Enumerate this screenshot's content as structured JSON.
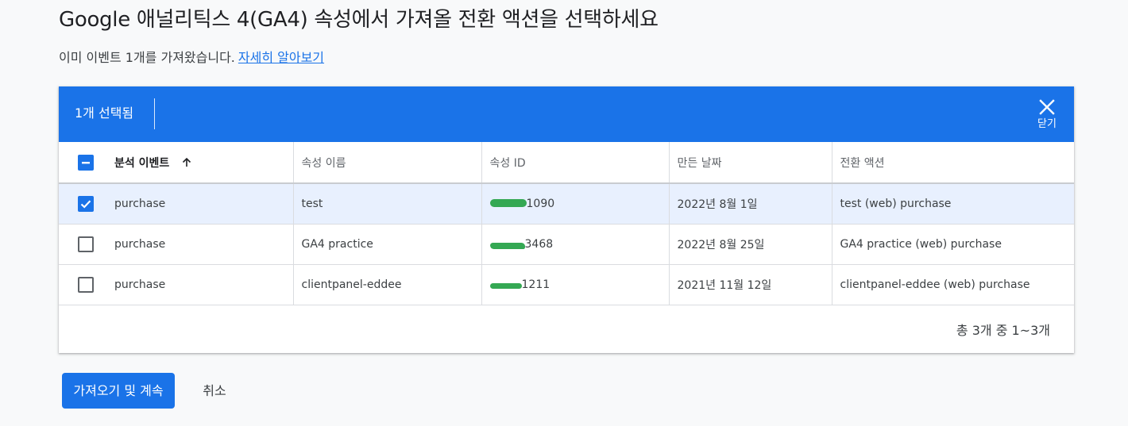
{
  "header": {
    "title": "Google 애널리틱스 4(GA4) 속성에서 가져올 전환 액션을 선택하세요",
    "subtitle_text": "이미 이벤트 1개를 가져왔습니다.",
    "learn_more_link": "자세히 알아보기"
  },
  "selection_bar": {
    "count_label": "1개 선택됨",
    "close_label": "닫기",
    "background_color": "#1a73e8"
  },
  "table": {
    "columns": [
      "분석 이벤트",
      "속성 이름",
      "속성 ID",
      "만든 날짜",
      "전환 액션"
    ],
    "sorted_column": "분석 이벤트",
    "sort_direction": "ascending",
    "header_checkbox_state": "indeterminate",
    "rows": [
      {
        "selected": true,
        "event": "purchase",
        "property_name": "test",
        "property_id_visible": "1090",
        "created": "2022년 8월 1일",
        "conversion_action": "test (web) purchase"
      },
      {
        "selected": false,
        "event": "purchase",
        "property_name": "GA4 practice",
        "property_id_visible": "3468",
        "created": "2022년 8월 25일",
        "conversion_action": "GA4 practice (web) purchase"
      },
      {
        "selected": false,
        "event": "purchase",
        "property_name": "clientpanel-eddee",
        "property_id_visible": "1211",
        "created": "2021년 11월 12일",
        "conversion_action": "clientpanel-eddee (web) purchase"
      }
    ],
    "pagination": "총 3개 중 1~3개"
  },
  "actions": {
    "primary_label": "가져오기 및 계속",
    "cancel_label": "취소"
  },
  "colors": {
    "accent": "#1a73e8",
    "redaction": "#34a853"
  }
}
